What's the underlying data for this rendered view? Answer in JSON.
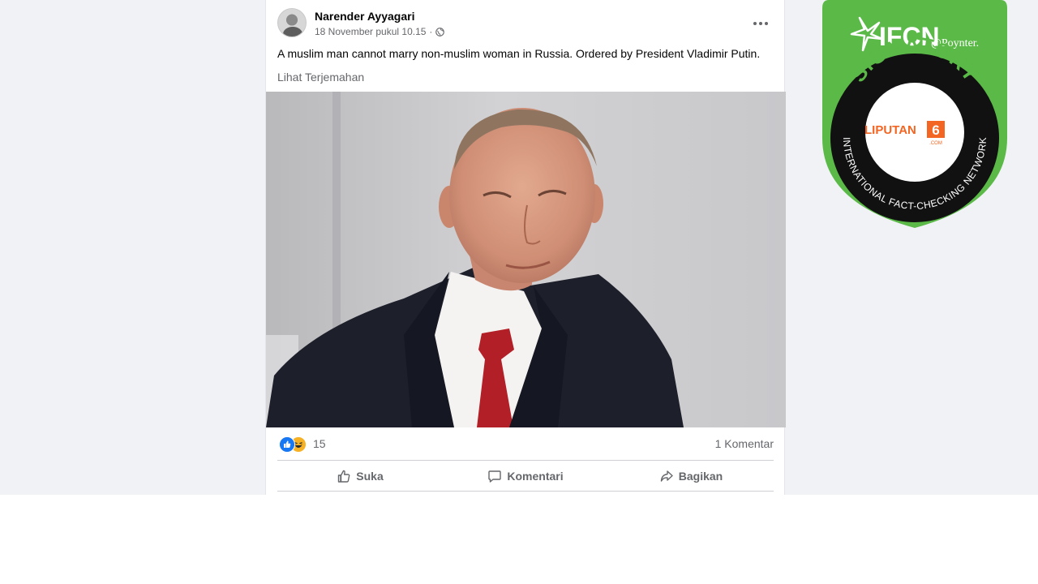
{
  "post": {
    "author": "Narender Ayyagari",
    "timestamp": "18 November pukul 10.15",
    "text": "A muslim man cannot marry non-muslim woman in Russia. Ordered by President Vladimir Putin.",
    "see_translation": "Lihat Terjemahan",
    "reaction_count": "15",
    "comment_count": "1 Komentar"
  },
  "actions": {
    "like": "Suka",
    "comment": "Komentari",
    "share": "Bagikan"
  },
  "badge": {
    "ifcn": "IFCN",
    "poynter": "@Poynter.",
    "signatory": "SIGNATORY",
    "network": "INTERNATIONAL FACT-CHECKING NETWORK",
    "logo_text": "LIPUTAN",
    "logo_digit": "6",
    "logo_sub": ".COM"
  },
  "colors": {
    "facebook_blue": "#1877f2",
    "badge_green": "#5ab947",
    "liputan_orange": "#f26522"
  },
  "icons": [
    "globe-icon",
    "more-icon",
    "like-icon",
    "comment-icon",
    "share-icon"
  ]
}
